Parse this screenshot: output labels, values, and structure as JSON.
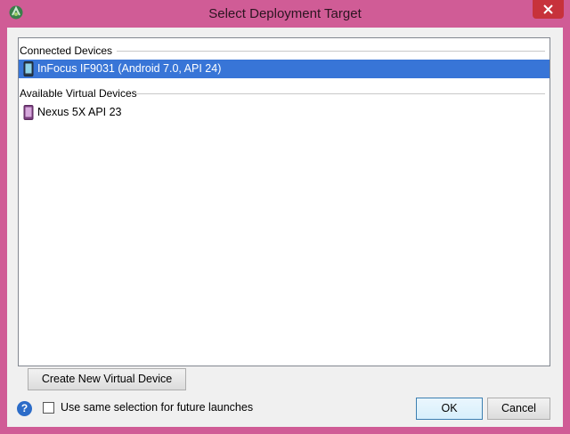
{
  "window": {
    "title": "Select Deployment Target",
    "app_icon": "android-studio-icon",
    "close_icon": "close-icon"
  },
  "groups": [
    {
      "label": "Connected Devices",
      "devices": [
        {
          "label": "InFocus IF9031 (Android 7.0, API 24)",
          "icon": "phone-device-icon",
          "selected": true
        }
      ]
    },
    {
      "label": "Available Virtual Devices",
      "devices": [
        {
          "label": "Nexus 5X API 23",
          "icon": "virtual-phone-icon",
          "selected": false
        }
      ]
    }
  ],
  "buttons": {
    "create_new_virtual_device": "Create New Virtual Device",
    "ok": "OK",
    "cancel": "Cancel"
  },
  "footer": {
    "help_icon": "help-icon",
    "help_glyph": "?",
    "checkbox_label": "Use same selection for future launches",
    "checkbox_checked": false
  },
  "colors": {
    "window_frame": "#d05c96",
    "selection": "#3875d7",
    "close_button": "#c7323b"
  }
}
